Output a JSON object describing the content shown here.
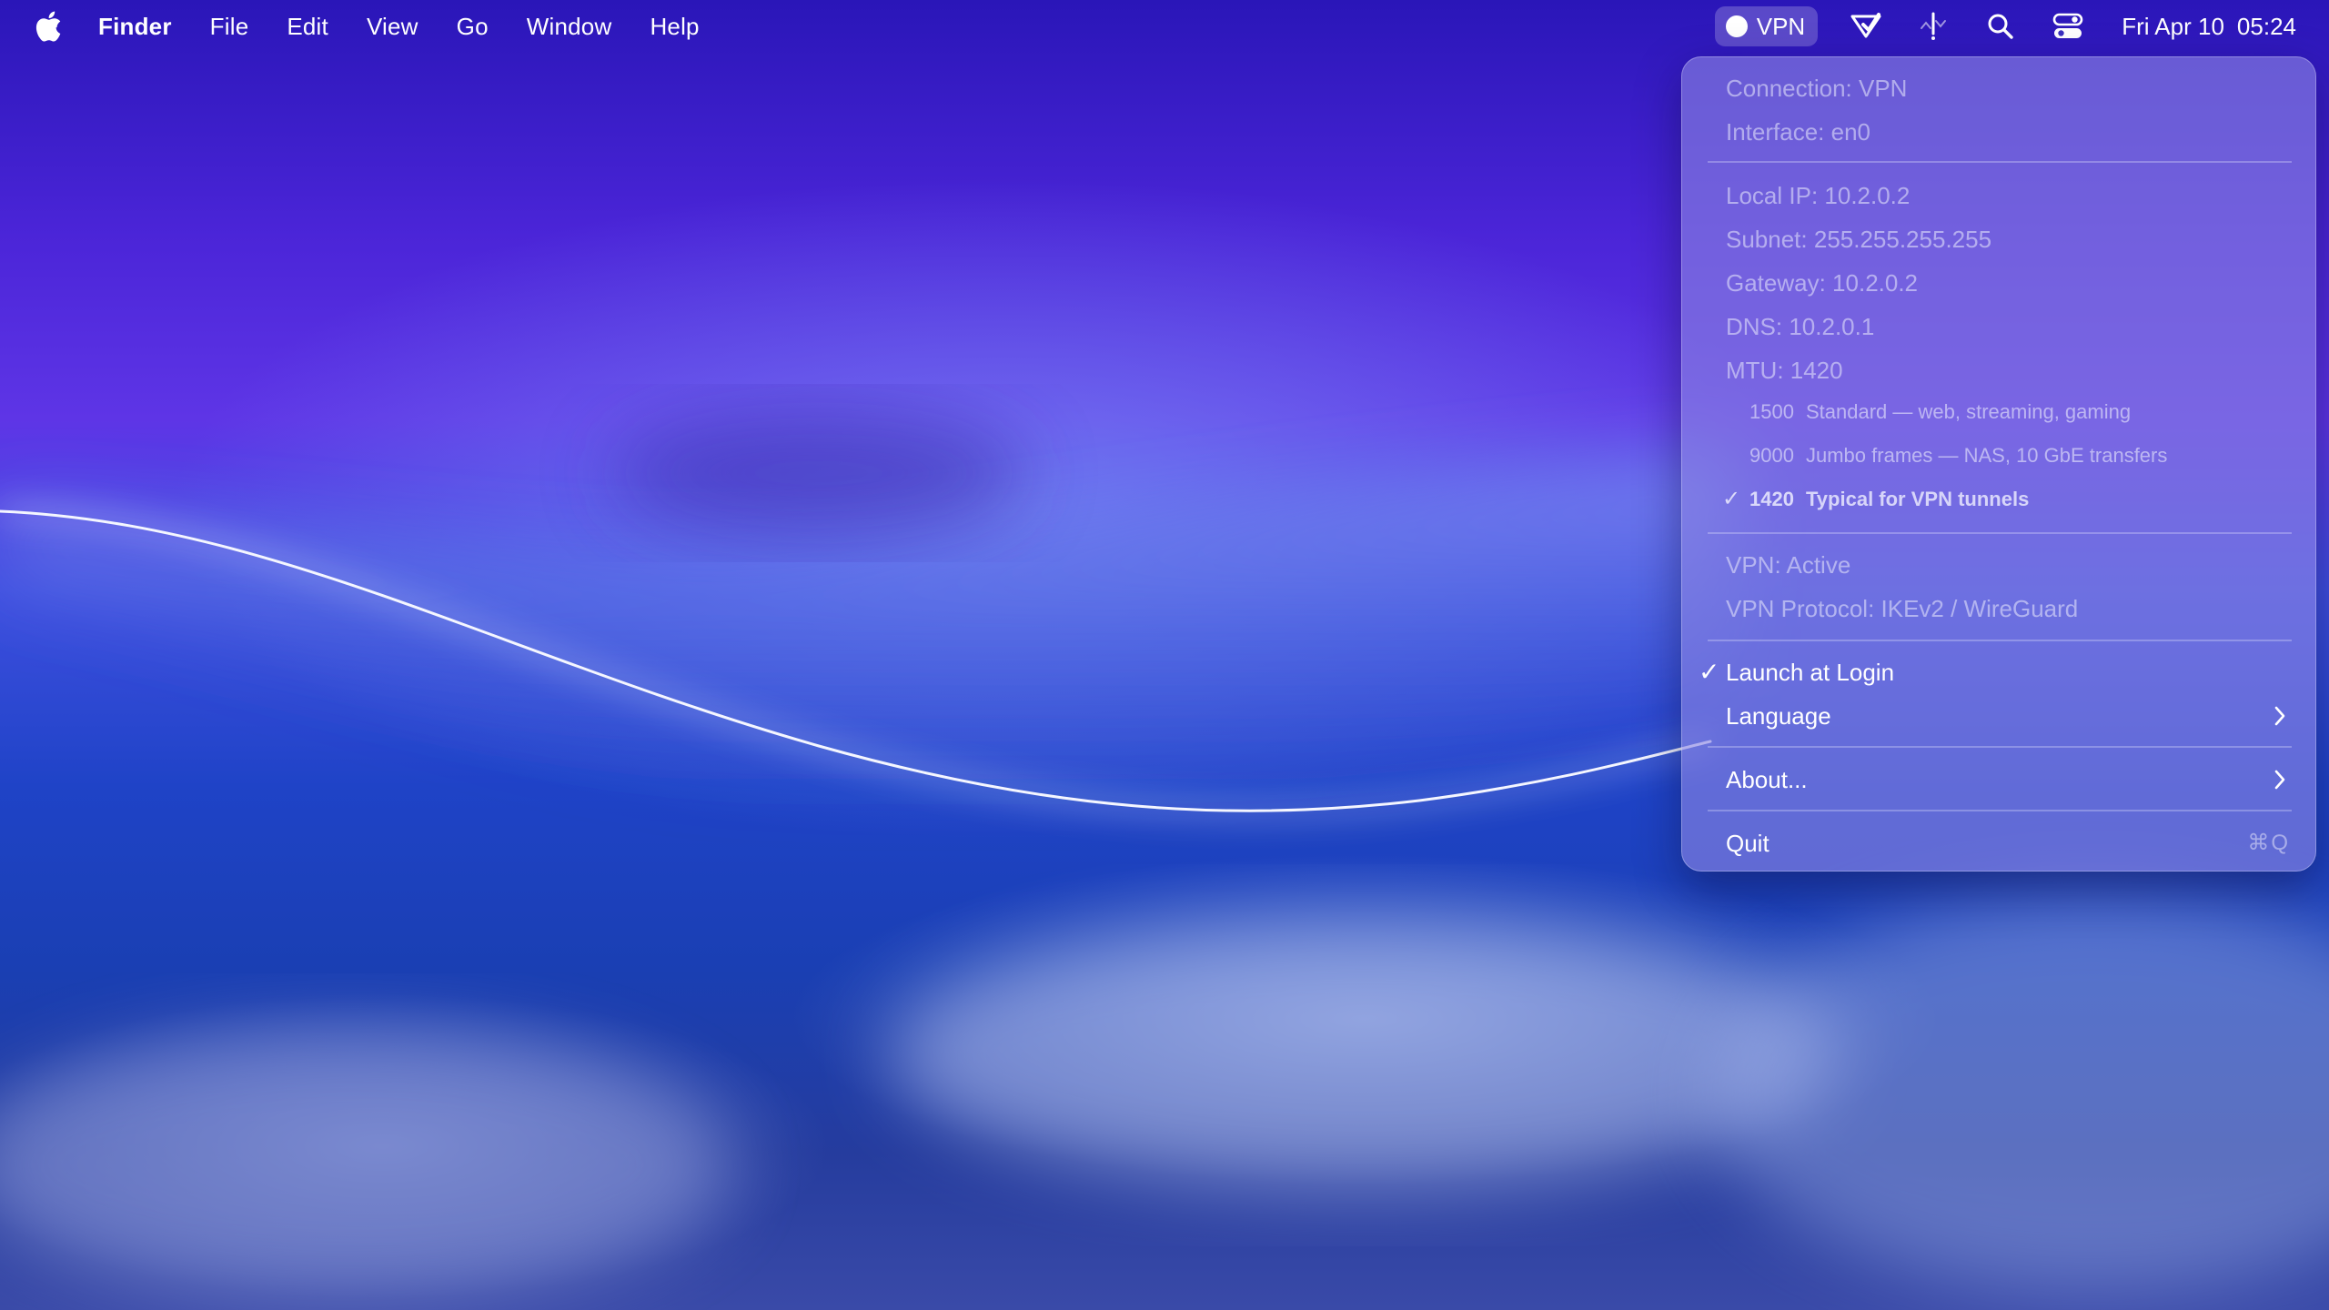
{
  "menubar": {
    "apple_icon": "apple-logo-icon",
    "app_name": "Finder",
    "menus": [
      "File",
      "Edit",
      "View",
      "Go",
      "Window",
      "Help"
    ],
    "status": {
      "vpn_label": "VPN",
      "icons": [
        "vpn-shield-check-icon",
        "network-activity-icon",
        "search-icon",
        "control-center-icon"
      ],
      "clock_day": "Fri Apr 10",
      "clock_time": "05:24"
    }
  },
  "dropdown": {
    "connection": "Connection: VPN",
    "interface": "Interface: en0",
    "local_ip": "Local IP: 10.2.0.2",
    "subnet": "Subnet: 255.255.255.255",
    "gateway": "Gateway: 10.2.0.2",
    "dns": "DNS: 10.2.0.1",
    "mtu": "MTU: 1420",
    "mtu_options": [
      {
        "value": "1500",
        "description": "Standard — web, streaming, gaming",
        "checked": false
      },
      {
        "value": "9000",
        "description": "Jumbo frames — NAS, 10 GbE transfers",
        "checked": false
      },
      {
        "value": "1420",
        "description": "Typical for VPN tunnels",
        "checked": true
      }
    ],
    "vpn_status": "VPN: Active",
    "vpn_protocol": "VPN Protocol: IKEv2 / WireGuard",
    "launch_at_login": "Launch at Login",
    "launch_at_login_checked": true,
    "language": "Language",
    "about": "About...",
    "quit": "Quit",
    "quit_shortcut": "⌘Q",
    "check_glyph": "✓"
  },
  "colors": {
    "menu_background": "#8a84e2",
    "wallpaper_top": "#2a16b8",
    "wallpaper_mid": "#5e35e6",
    "wallpaper_bottom": "#1a3fb3"
  }
}
